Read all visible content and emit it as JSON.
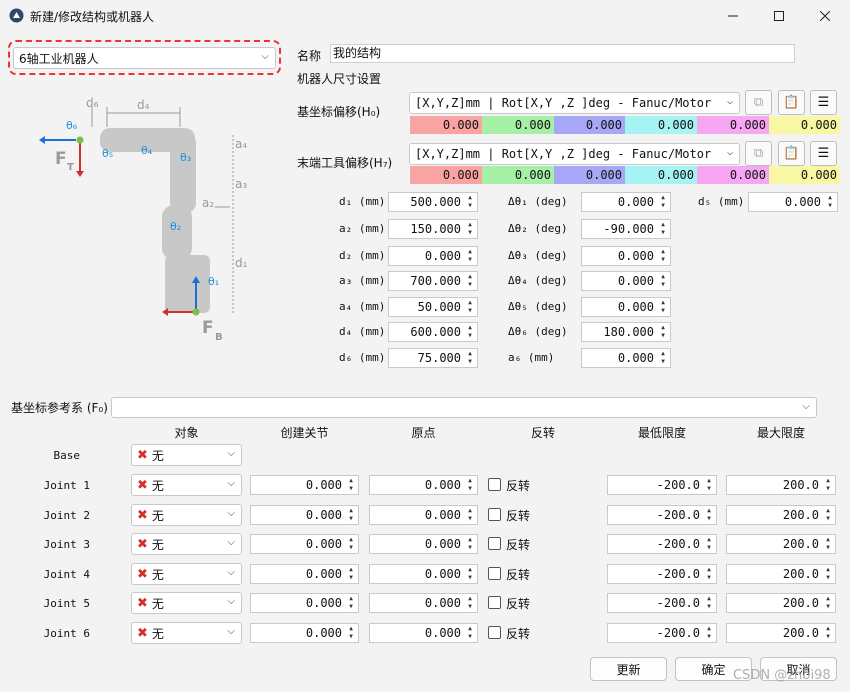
{
  "window": {
    "title": "新建/修改结构或机器人",
    "min_icon": "minimize-icon",
    "max_icon": "maximize-icon",
    "close_icon": "close-icon"
  },
  "robot_type": "6轴工业机器人",
  "name_label": "名称",
  "name_value": "我的结构",
  "size_header": "机器人尺寸设置",
  "base_offset": {
    "label": "基坐标偏移(H₀)",
    "format": "[X,Y,Z]mm | Rot[X,Y ,Z  ]deg - Fanuc/Motor",
    "values": [
      "0.000",
      "0.000",
      "0.000",
      "0.000",
      "0.000",
      "0.000"
    ]
  },
  "tool_offset": {
    "label": "末端工具偏移(H₇)",
    "format": "[X,Y,Z]mm | Rot[X,Y ,Z  ]deg - Fanuc/Motor",
    "values": [
      "0.000",
      "0.000",
      "0.000",
      "0.000",
      "0.000",
      "0.000"
    ]
  },
  "value_colors": [
    "#f9a3a3",
    "#a6f0a6",
    "#a7a7f7",
    "#a6f3f3",
    "#f7a6f2",
    "#f7f7a4"
  ],
  "params_left": [
    {
      "label": "d₁ (mm)",
      "value": "500.000"
    },
    {
      "label": "a₂ (mm)",
      "value": "150.000"
    },
    {
      "label": "d₂ (mm)",
      "value": "0.000"
    },
    {
      "label": "a₃ (mm)",
      "value": "700.000"
    },
    {
      "label": "a₄ (mm)",
      "value": "50.000"
    },
    {
      "label": "d₄ (mm)",
      "value": "600.000"
    },
    {
      "label": "d₆ (mm)",
      "value": "75.000"
    }
  ],
  "params_mid": [
    {
      "label": "Δθ₁ (deg)",
      "value": "0.000"
    },
    {
      "label": "Δθ₂ (deg)",
      "value": "-90.000"
    },
    {
      "label": "Δθ₃ (deg)",
      "value": "0.000"
    },
    {
      "label": "Δθ₄ (deg)",
      "value": "0.000"
    },
    {
      "label": "Δθ₅ (deg)",
      "value": "0.000"
    },
    {
      "label": "Δθ₆ (deg)",
      "value": "180.000"
    },
    {
      "label": "a₆ (mm)",
      "value": "0.000"
    }
  ],
  "param_right": {
    "label": "d₅ (mm)",
    "value": "0.000"
  },
  "diagram": {
    "labels": [
      "d₆",
      "d₄",
      "a₄",
      "a₃",
      "a₂",
      "d₁",
      "θ₆",
      "θ₅",
      "θ₄",
      "θ₃",
      "θ₂",
      "θ₁",
      "F",
      "T",
      "F",
      "B"
    ]
  },
  "ref_frame_label": "基坐标参考系 (F₀)",
  "ref_frame_value": "",
  "table": {
    "headers": [
      "对象",
      "创建关节",
      "原点",
      "反转",
      "最低限度",
      "最大限度"
    ],
    "base_label": "Base",
    "base_object": "无",
    "rows": [
      {
        "label": "Joint 1",
        "object": "无",
        "joint": "0.000",
        "origin": "0.000",
        "invert": "反转",
        "min": "-200.0",
        "max": "200.0"
      },
      {
        "label": "Joint 2",
        "object": "无",
        "joint": "0.000",
        "origin": "0.000",
        "invert": "反转",
        "min": "-200.0",
        "max": "200.0"
      },
      {
        "label": "Joint 3",
        "object": "无",
        "joint": "0.000",
        "origin": "0.000",
        "invert": "反转",
        "min": "-200.0",
        "max": "200.0"
      },
      {
        "label": "Joint 4",
        "object": "无",
        "joint": "0.000",
        "origin": "0.000",
        "invert": "反转",
        "min": "-200.0",
        "max": "200.0"
      },
      {
        "label": "Joint 5",
        "object": "无",
        "joint": "0.000",
        "origin": "0.000",
        "invert": "反转",
        "min": "-200.0",
        "max": "200.0"
      },
      {
        "label": "Joint 6",
        "object": "无",
        "joint": "0.000",
        "origin": "0.000",
        "invert": "反转",
        "min": "-200.0",
        "max": "200.0"
      }
    ]
  },
  "buttons": {
    "update": "更新",
    "ok": "确定",
    "cancel": "取消"
  },
  "watermark": "CSDN @zhbi98"
}
